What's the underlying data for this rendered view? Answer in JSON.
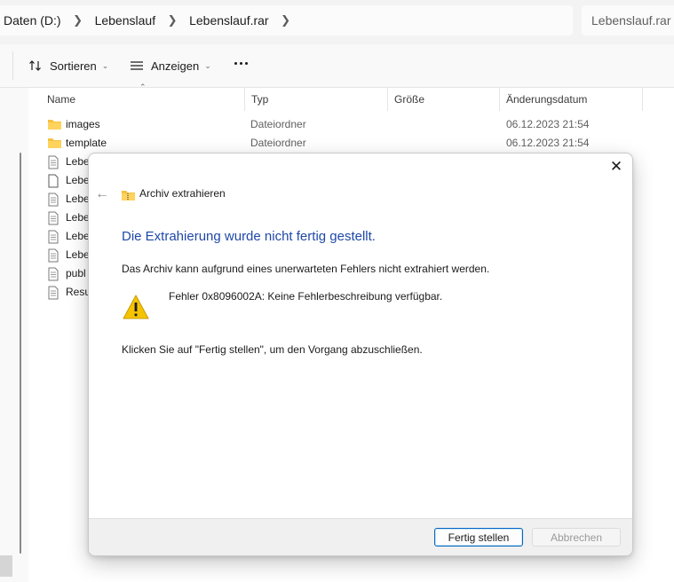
{
  "addressbar": {
    "crumbs": [
      "Daten (D:)",
      "Lebenslauf",
      "Lebenslauf.rar"
    ],
    "search_placeholder": "Lebenslauf.rar d"
  },
  "commandbar": {
    "sort_label": "Sortieren",
    "view_label": "Anzeigen"
  },
  "filelist": {
    "columns": [
      "Name",
      "Typ",
      "Größe",
      "Änderungsdatum"
    ],
    "rows": [
      {
        "name": "images",
        "type": "Dateiordner",
        "date": "06.12.2023 21:54",
        "icon": "folder-icon"
      },
      {
        "name": "template",
        "type": "Dateiordner",
        "date": "06.12.2023 21:54",
        "icon": "folder-icon"
      },
      {
        "name": "Lebe",
        "type": "",
        "date": "",
        "icon": "text-file-icon"
      },
      {
        "name": "Lebe",
        "type": "",
        "date": "",
        "icon": "file-icon"
      },
      {
        "name": "Lebe",
        "type": "",
        "date": "",
        "icon": "text-file-icon"
      },
      {
        "name": "Lebe",
        "type": "",
        "date": "",
        "icon": "text-file-icon"
      },
      {
        "name": "Lebe",
        "type": "",
        "date": "",
        "icon": "text-file-icon"
      },
      {
        "name": "Lebe",
        "type": "",
        "date": "",
        "icon": "text-file-icon"
      },
      {
        "name": "publ",
        "type": "",
        "date": "",
        "icon": "text-file-icon"
      },
      {
        "name": "Resu",
        "type": "",
        "date": "",
        "icon": "text-file-icon"
      }
    ]
  },
  "dialog": {
    "title": "Archiv extrahieren",
    "heading": "Die Extrahierung wurde nicht fertig gestellt.",
    "message": "Das Archiv kann aufgrund eines unerwarteten Fehlers nicht extrahiert werden.",
    "error": "Fehler 0x8096002A: Keine Fehlerbeschreibung verfügbar.",
    "hint": "Klicken Sie auf \"Fertig stellen\", um den Vorgang abzuschließen.",
    "finish_label": "Fertig stellen",
    "cancel_label": "Abbrechen"
  },
  "colors": {
    "heading_blue": "#1f48a8",
    "accent": "#0067c0",
    "warning": "#f5c400"
  }
}
